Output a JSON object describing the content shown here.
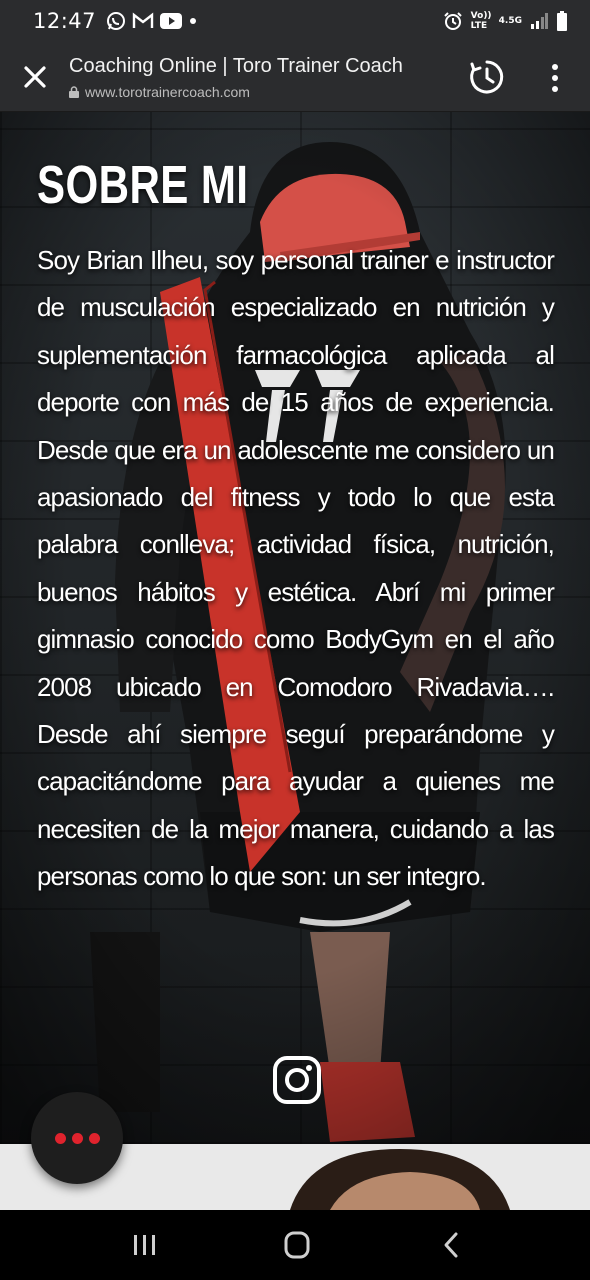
{
  "status_bar": {
    "time": "12:47",
    "left_icons": [
      "whatsapp-icon",
      "gmail-icon",
      "youtube-icon",
      "dot-icon"
    ],
    "right_icons": [
      "alarm-icon",
      "volte-icon",
      "4g-icon",
      "signal-icon",
      "battery-icon"
    ],
    "volte_label": "Vo)) LTE",
    "network_label": "4.5G"
  },
  "browser": {
    "title": "Coaching Online | Toro Trainer Coach",
    "url": "www.torotrainercoach.com",
    "icons": [
      "close-icon",
      "lock-icon",
      "history-icon",
      "more-vert-icon"
    ]
  },
  "about": {
    "heading": "SOBRE MI",
    "body": "Soy Brian Ilheu, soy personal trainer e instructor de musculación especializado en nutrición y suplementación farmacológica aplicada al deporte con más de 15 años de experiencia. Desde que era un adolescente me considero un apasionado del fitness y todo lo que esta palabra conlleva; actividad física, nutrición, buenos hábitos y estética. Abrí mi primer gimnasio conocido como BodyGym en el año 2008 ubicado en Comodoro Rivadavia…. Desde ahí siempre seguí preparándome y capacitándome para ayudar a quienes me necesiten de la mejor manera, cuidando a las personas como lo que son: un ser integro."
  },
  "social": {
    "icon": "instagram-icon"
  },
  "fab": {
    "icon": "more-horiz-icon",
    "color": "#e0232d"
  },
  "nav_bar": {
    "icons": [
      "recents-icon",
      "home-icon",
      "back-icon"
    ]
  },
  "colors": {
    "bar_bg": "#2b2c2e",
    "accent_red": "#e0232d"
  }
}
